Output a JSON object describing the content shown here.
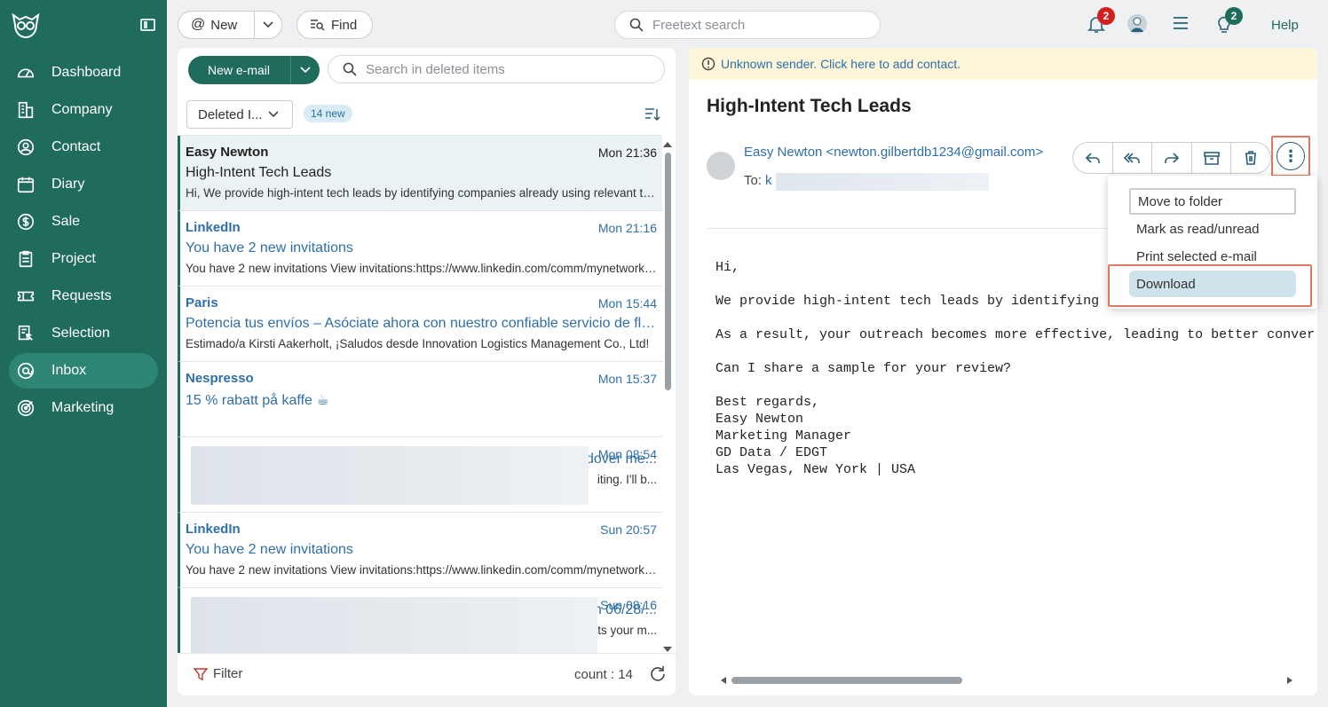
{
  "sidebar": {
    "items": [
      {
        "label": "Dashboard",
        "icon": "dashboard-icon"
      },
      {
        "label": "Company",
        "icon": "company-icon"
      },
      {
        "label": "Contact",
        "icon": "contact-icon"
      },
      {
        "label": "Diary",
        "icon": "diary-icon"
      },
      {
        "label": "Sale",
        "icon": "sale-icon"
      },
      {
        "label": "Project",
        "icon": "project-icon"
      },
      {
        "label": "Requests",
        "icon": "requests-icon"
      },
      {
        "label": "Selection",
        "icon": "selection-icon"
      },
      {
        "label": "Inbox",
        "icon": "inbox-icon"
      },
      {
        "label": "Marketing",
        "icon": "marketing-icon"
      }
    ],
    "active": "Inbox"
  },
  "topbar": {
    "new_label": "New",
    "find_label": "Find",
    "search_placeholder": "Freetext search",
    "notifications_count": "2",
    "tips_count": "2",
    "help_label": "Help"
  },
  "list": {
    "new_email_label": "New e-mail",
    "search_placeholder": "Search in deleted items",
    "folder_label": "Deleted I...",
    "new_count_label": "14 new",
    "filter_label": "Filter",
    "count_label": "count : 14",
    "items": [
      {
        "sender": "Easy Newton",
        "time": "Mon 21:36",
        "subject": "High-Intent Tech Leads",
        "preview": "Hi, We provide high-intent tech leads by identifying companies already using relevant technologies..."
      },
      {
        "sender": "LinkedIn",
        "time": "Mon 21:16",
        "subject": "You have 2 new invitations",
        "preview": "You have 2 new invitations View invitations:https://www.linkedin.com/comm/mynetwork/invitation-manager"
      },
      {
        "sender": "Paris",
        "time": "Mon 15:44",
        "subject": "Potencia tus envíos – Asóciate ahora con nuestro confiable servicio de flete",
        "preview": "Estimado/a Kirsti Aakerholt, ¡Saludos desde Innovation Logistics Management Co., Ltd!"
      },
      {
        "sender": "Nespresso",
        "time": "Mon 15:37",
        "subject": "15 % rabatt på kaffe ☕",
        "preview": ""
      },
      {
        "sender": "",
        "time": "Mon 08:54",
        "subject": "dover me...",
        "preview": "iting. I'll b..."
      },
      {
        "sender": "LinkedIn",
        "time": "Sun 20:57",
        "subject": "You have 2 new invitations",
        "preview": "You have 2 new invitations View invitations:https://www.linkedin.com/comm/mynetwork/invitation-manager"
      },
      {
        "sender": "",
        "time": "Sun 08:16",
        "subject": "n 06/28/...",
        "preview": "ts your m..."
      }
    ]
  },
  "reader": {
    "banner": "Unknown sender. Click here to add contact.",
    "title": "High-Intent Tech Leads",
    "from": "Easy Newton <newton.gilbertdb1234@gmail.com>",
    "to_label": "To:",
    "to_value": "k",
    "body": "Hi,\n\nWe provide high-intent tech leads by identifying c\n\nAs a result, your outreach becomes more effective, leading to better conver\n\nCan I share a sample for your review?\n\nBest regards,\nEasy Newton\nMarketing Manager\nGD Data / EDGT\nLas Vegas, New York | USA"
  },
  "menu": {
    "items": [
      "Move to folder",
      "Mark as read/unread",
      "Print selected e-mail",
      "Download"
    ]
  }
}
